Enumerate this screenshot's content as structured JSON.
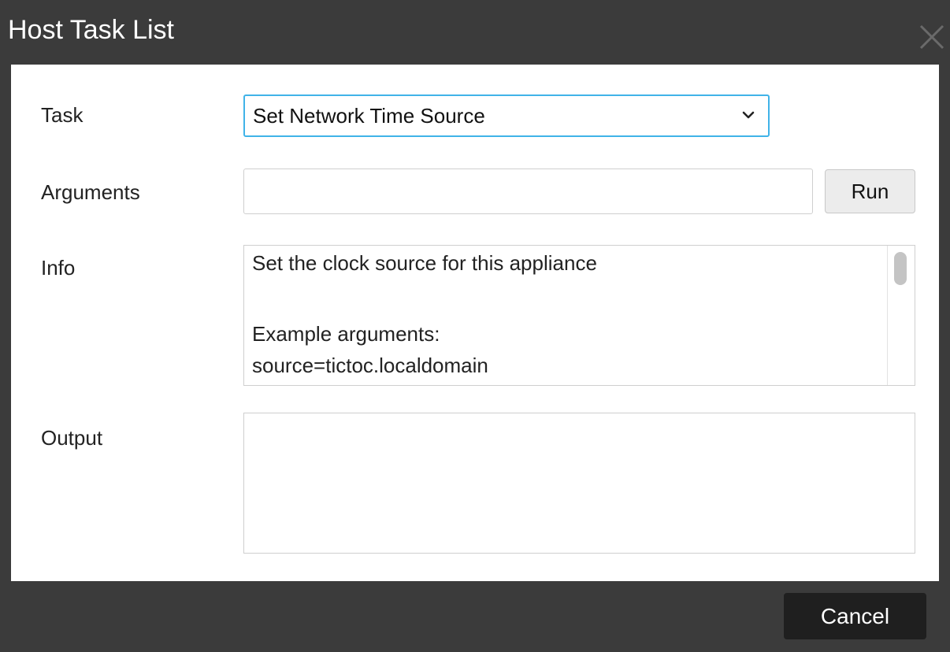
{
  "dialog": {
    "title": "Host Task List",
    "close_icon": "close-icon"
  },
  "form": {
    "task_label": "Task",
    "task_selected": "Set Network Time Source",
    "arguments_label": "Arguments",
    "arguments_value": "",
    "run_label": "Run",
    "info_label": "Info",
    "info_lines": [
      "Set the clock source for this appliance",
      "",
      "Example arguments:",
      "source=tictoc.localdomain"
    ],
    "output_label": "Output",
    "output_value": ""
  },
  "footer": {
    "cancel_label": "Cancel"
  },
  "colors": {
    "chrome": "#3b3b3b",
    "panel": "#ffffff",
    "focus_border": "#40b3e8",
    "cancel_bg": "#1f1f1f"
  }
}
